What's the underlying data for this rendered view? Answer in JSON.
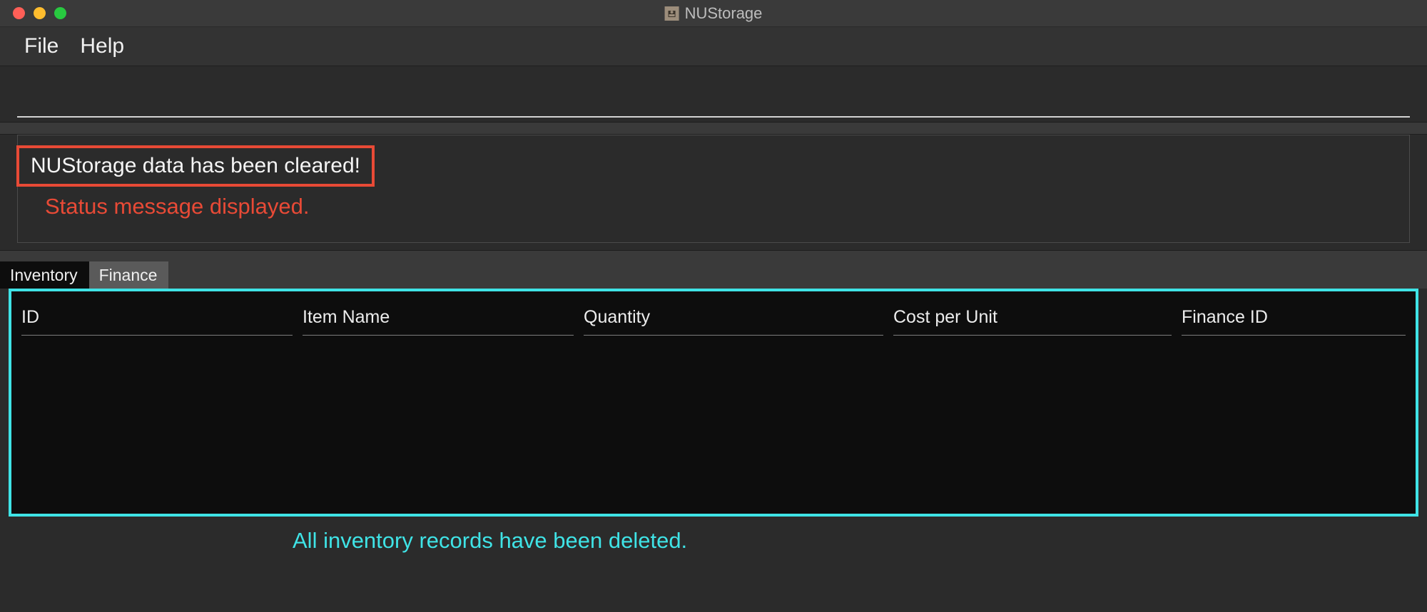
{
  "window": {
    "title": "NUStorage"
  },
  "menu": {
    "file": "File",
    "help": "Help"
  },
  "status": {
    "message": "NUStorage data has been cleared!",
    "annotation": "Status message displayed."
  },
  "tabs": {
    "inventory": "Inventory",
    "finance": "Finance",
    "active": "inventory"
  },
  "table": {
    "columns": {
      "id": "ID",
      "item_name": "Item Name",
      "quantity": "Quantity",
      "cost_per_unit": "Cost per Unit",
      "finance_id": "Finance ID"
    },
    "rows": []
  },
  "annotations": {
    "table_note": "All inventory records have been deleted."
  },
  "colors": {
    "annotation_red": "#e84a36",
    "annotation_cyan": "#3fe3e6",
    "bg_dark": "#0d0d0d",
    "bg_mid": "#2b2b2b"
  }
}
